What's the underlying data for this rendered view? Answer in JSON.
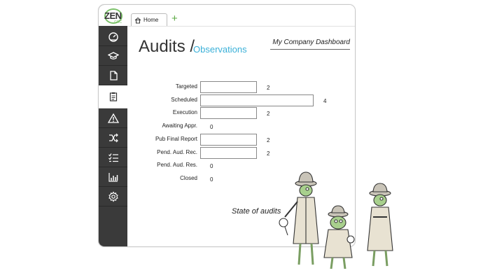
{
  "app": {
    "logo_text": "ZEN",
    "logo_sub": "GRC"
  },
  "sidebar": {
    "items": [
      {
        "icon": "dashboard-icon"
      },
      {
        "icon": "graduation-cap-icon"
      },
      {
        "icon": "document-icon"
      },
      {
        "icon": "clipboard-checklist-icon",
        "active": true
      },
      {
        "icon": "warning-icon"
      },
      {
        "icon": "shuffle-icon"
      },
      {
        "icon": "checklist-icon"
      },
      {
        "icon": "bar-chart-icon"
      },
      {
        "icon": "gear-icon"
      }
    ]
  },
  "tabs": {
    "home_label": "Home",
    "add_symbol": "+"
  },
  "header": {
    "title": "Audits",
    "separator": "/",
    "subtitle": "Observations",
    "dashboard_label": "My Company Dashboard"
  },
  "chart_data": {
    "type": "bar",
    "orientation": "horizontal",
    "title": "State of audits",
    "categories": [
      "Targeted",
      "Scheduled",
      "Execution",
      "Awaiting Appr.",
      "Pub Final Report",
      "Pend. Aud. Rec.",
      "Pend. Aud. Res.",
      "Closed"
    ],
    "values": [
      2,
      4,
      2,
      0,
      2,
      2,
      0,
      0
    ],
    "xlim": [
      0,
      4
    ],
    "grid": false
  },
  "colors": {
    "sidebar_bg": "#3a3a3a",
    "accent_blue": "#3ab0d8",
    "accent_green": "#7cc16a"
  }
}
